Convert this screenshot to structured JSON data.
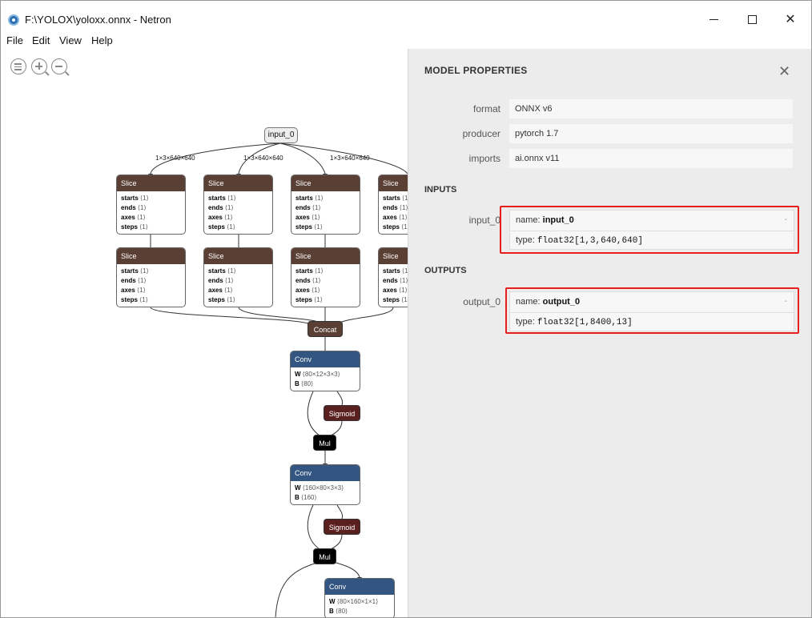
{
  "window": {
    "title": "F:\\YOLOX\\yoloxx.onnx - Netron"
  },
  "menu": [
    "File",
    "Edit",
    "View",
    "Help"
  ],
  "toolbar": {
    "icons": [
      "menu-icon",
      "zoom-in-icon",
      "zoom-out-icon"
    ]
  },
  "graph": {
    "input_node": "input_0",
    "edge_label": "1×3×640×640",
    "slice": {
      "title": "Slice",
      "attrs": [
        {
          "k": "starts",
          "v": "⟨1⟩"
        },
        {
          "k": "ends",
          "v": "⟨1⟩"
        },
        {
          "k": "axes",
          "v": "⟨1⟩"
        },
        {
          "k": "steps",
          "v": "⟨1⟩"
        }
      ]
    },
    "concat": "Concat",
    "sigmoid": "Sigmoid",
    "mul": "Mul",
    "conv_title": "Conv",
    "conv1": {
      "w": "W",
      "w_shape": "⟨80×12×3×3⟩",
      "b": "B",
      "b_shape": "⟨80⟩"
    },
    "conv2": {
      "w": "W",
      "w_shape": "⟨160×80×3×3⟩",
      "b": "B",
      "b_shape": "⟨160⟩"
    },
    "conv3": {
      "w": "W",
      "w_shape": "⟨80×160×1×1⟩",
      "b": "B",
      "b_shape": "⟨80⟩"
    }
  },
  "sidebar": {
    "title": "MODEL PROPERTIES",
    "properties": [
      {
        "label": "format",
        "value": "ONNX v6"
      },
      {
        "label": "producer",
        "value": "pytorch 1.7"
      },
      {
        "label": "imports",
        "value": "ai.onnx v11"
      }
    ],
    "inputs_title": "INPUTS",
    "input": {
      "label": "input_0",
      "name_prefix": "name: ",
      "name": "input_0",
      "type_prefix": "type: ",
      "type": "float32[1,3,640,640]",
      "dash": "-"
    },
    "outputs_title": "OUTPUTS",
    "output": {
      "label": "output_0",
      "name_prefix": "name: ",
      "name": "output_0",
      "type_prefix": "type: ",
      "type": "float32[1,8400,13]",
      "dash": "-"
    }
  },
  "colors": {
    "slice_header": "#5a3f35",
    "conv_header": "#335582",
    "sigmoid": "#5a1f1f",
    "mul": "#000000",
    "highlight": "#e81e1e",
    "sidebar_bg": "#ececec"
  }
}
